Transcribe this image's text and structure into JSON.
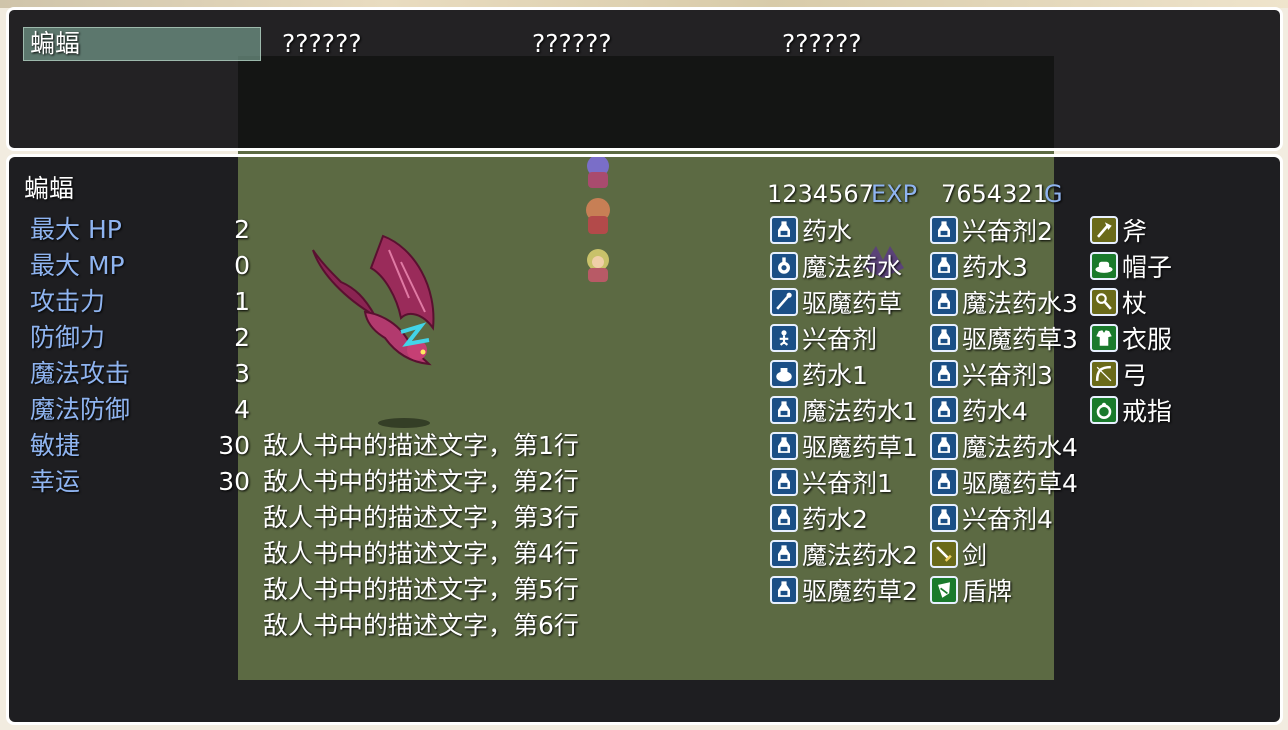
{
  "enemy_list": {
    "entries": [
      "蝙蝠",
      "??????",
      "??????",
      "??????"
    ],
    "selected_index": 0
  },
  "enemy": {
    "name": "蝙蝠",
    "stats": [
      {
        "label": "最大 HP",
        "value": "2"
      },
      {
        "label": "最大 MP",
        "value": "0"
      },
      {
        "label": "攻击力",
        "value": "1"
      },
      {
        "label": "防御力",
        "value": "2"
      },
      {
        "label": "魔法攻击",
        "value": "3"
      },
      {
        "label": "魔法防御",
        "value": "4"
      },
      {
        "label": "敏捷",
        "value": "30"
      },
      {
        "label": "幸运",
        "value": "30"
      }
    ],
    "exp": "1234567",
    "exp_unit": "EXP",
    "gold": "7654321",
    "gold_unit": "G",
    "description": [
      "敌人书中的描述文字，第1行",
      "敌人书中的描述文字，第2行",
      "敌人书中的描述文字，第3行",
      "敌人书中的描述文字，第4行",
      "敌人书中的描述文字，第5行",
      "敌人书中的描述文字，第6行"
    ],
    "drops": {
      "col1": [
        {
          "name": "药水",
          "icon": "potion-icon"
        },
        {
          "name": "魔法药水",
          "icon": "magic-potion-icon"
        },
        {
          "name": "驱魔药草",
          "icon": "herb-icon"
        },
        {
          "name": "兴奋剂",
          "icon": "stimulant-icon"
        },
        {
          "name": "药水1",
          "icon": "pot-icon"
        },
        {
          "name": "魔法药水1",
          "icon": "potion-icon"
        },
        {
          "name": "驱魔药草1",
          "icon": "potion-icon"
        },
        {
          "name": "兴奋剂1",
          "icon": "potion-icon"
        },
        {
          "name": "药水2",
          "icon": "potion-icon"
        },
        {
          "name": "魔法药水2",
          "icon": "potion-icon"
        },
        {
          "name": "驱魔药草2",
          "icon": "potion-icon"
        }
      ],
      "col2": [
        {
          "name": "兴奋剂2",
          "icon": "potion-icon"
        },
        {
          "name": "药水3",
          "icon": "potion-icon"
        },
        {
          "name": "魔法药水3",
          "icon": "potion-icon"
        },
        {
          "name": "驱魔药草3",
          "icon": "potion-icon"
        },
        {
          "name": "兴奋剂3",
          "icon": "potion-icon"
        },
        {
          "name": "药水4",
          "icon": "potion-icon"
        },
        {
          "name": "魔法药水4",
          "icon": "potion-icon"
        },
        {
          "name": "驱魔药草4",
          "icon": "potion-icon"
        },
        {
          "name": "兴奋剂4",
          "icon": "potion-icon"
        },
        {
          "name": "剑",
          "icon": "sword-icon"
        },
        {
          "name": "盾牌",
          "icon": "shield-icon"
        }
      ],
      "col3": [
        {
          "name": "斧",
          "icon": "axe-icon"
        },
        {
          "name": "帽子",
          "icon": "hat-icon"
        },
        {
          "name": "杖",
          "icon": "staff-icon"
        },
        {
          "name": "衣服",
          "icon": "clothes-icon"
        },
        {
          "name": "弓",
          "icon": "bow-icon"
        },
        {
          "name": "戒指",
          "icon": "ring-icon"
        }
      ]
    }
  },
  "colors": {
    "window_bg": "#0c0c10",
    "window_border": "#ffffff",
    "label_blue": "#8fb4f0",
    "map_green": "#5c6a43",
    "selection": "#8cbeaa"
  }
}
